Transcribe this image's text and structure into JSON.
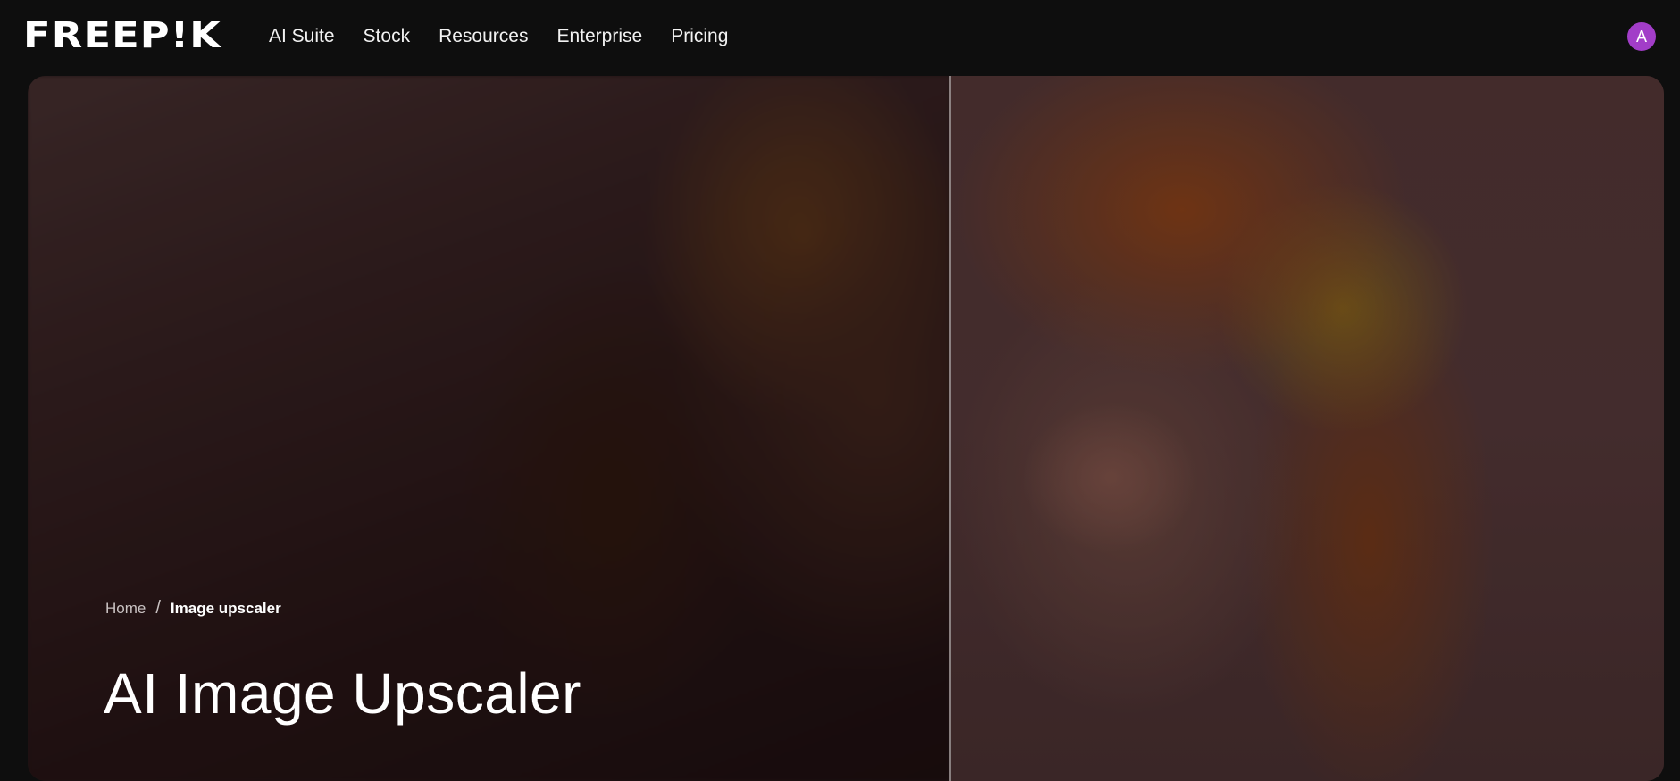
{
  "header": {
    "logo_text": "FREEP!K",
    "nav": [
      {
        "label": "AI Suite"
      },
      {
        "label": "Stock"
      },
      {
        "label": "Resources"
      },
      {
        "label": "Enterprise"
      },
      {
        "label": "Pricing"
      }
    ],
    "avatar_initial": "A"
  },
  "hero": {
    "breadcrumb": {
      "home": "Home",
      "separator": "/",
      "current": "Image upscaler"
    },
    "title": "AI Image Upscaler",
    "comparison_split": 0.56
  },
  "colors": {
    "background": "#0e0e0e",
    "avatar": "#a23dc8",
    "text": "#ffffff"
  }
}
